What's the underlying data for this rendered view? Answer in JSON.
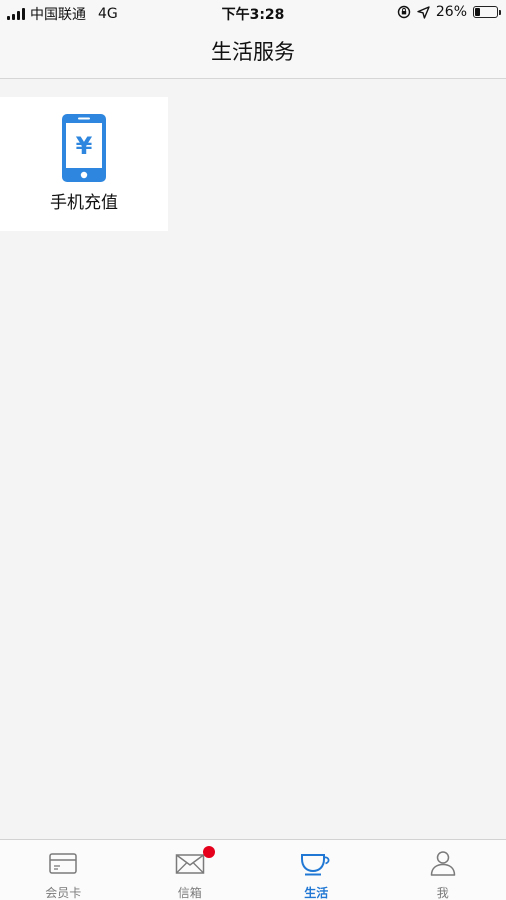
{
  "status_bar": {
    "carrier": "中国联通",
    "network": "4G",
    "time": "下午3:28",
    "battery_percent": "26%",
    "battery_level": 0.26,
    "icons": [
      "signal-icon",
      "orientation-lock-icon",
      "location-icon",
      "battery-icon"
    ]
  },
  "header": {
    "title": "生活服务"
  },
  "services": [
    {
      "label": "手机充值",
      "icon": "mobile-recharge-icon",
      "icon_glyph": "¥"
    }
  ],
  "tabs": [
    {
      "label": "会员卡",
      "icon": "card-icon",
      "active": false,
      "badge": false
    },
    {
      "label": "信箱",
      "icon": "envelope-icon",
      "active": false,
      "badge": true
    },
    {
      "label": "生活",
      "icon": "cup-icon",
      "active": true,
      "badge": false
    },
    {
      "label": "我",
      "icon": "person-icon",
      "active": false,
      "badge": false
    }
  ],
  "colors": {
    "accent": "#2178d4",
    "icon_blue": "#2e86de",
    "badge": "#e5001c",
    "inactive": "#7a7a7a",
    "background": "#f4f4f4"
  }
}
